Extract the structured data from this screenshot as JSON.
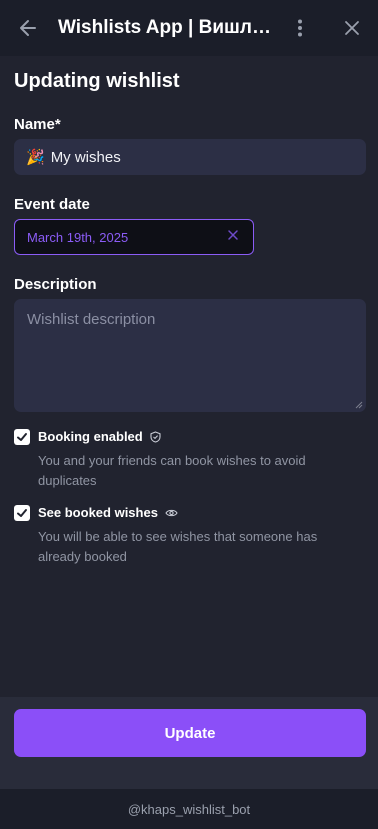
{
  "header": {
    "title": "Wishlists App | Вишли...",
    "back_icon": "arrow-left-icon",
    "more_icon": "more-vertical-icon",
    "close_icon": "close-icon"
  },
  "page": {
    "title": "Updating wishlist"
  },
  "form": {
    "name_label": "Name*",
    "name_emoji": "🎉",
    "name_value": "My wishes",
    "date_label": "Event date",
    "date_value": "March 19th, 2025",
    "description_label": "Description",
    "description_placeholder": "Wishlist description"
  },
  "options": [
    {
      "title": "Booking enabled",
      "icon": "shield-check-icon",
      "checked": true,
      "description": "You and your friends can book wishes to avoid duplicates"
    },
    {
      "title": "See booked wishes",
      "icon": "eye-icon",
      "checked": true,
      "description": "You will be able to see wishes that someone has already booked"
    }
  ],
  "actions": {
    "update_label": "Update"
  },
  "footer": {
    "bot_name": "@khaps_wishlist_bot"
  },
  "colors": {
    "accent": "#8b4ff8",
    "background": "#21232f",
    "field": "#2c2f45"
  }
}
